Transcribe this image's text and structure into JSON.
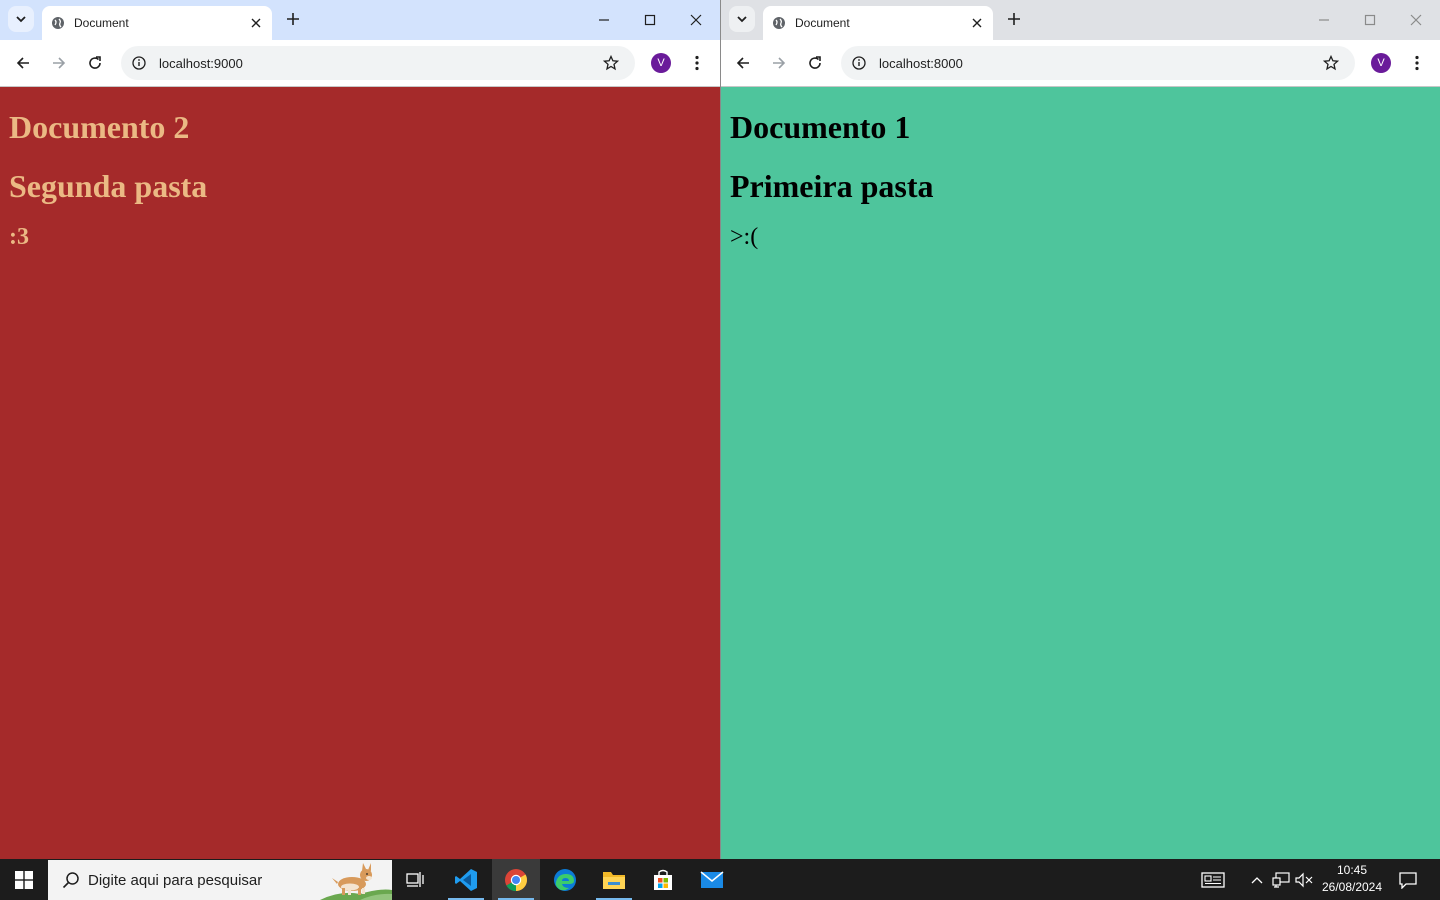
{
  "windows": [
    {
      "id": "left",
      "tab_title": "Document",
      "url": "localhost:9000",
      "avatar_letter": "V",
      "page": {
        "heading1": "Documento 2",
        "heading2": "Segunda pasta",
        "heading3": ":3"
      },
      "colors": {
        "background": "#a52a2a",
        "text": "#ebb984"
      }
    },
    {
      "id": "right",
      "tab_title": "Document",
      "url": "localhost:8000",
      "avatar_letter": "V",
      "page": {
        "heading1": "Documento 1",
        "heading2": "Primeira pasta",
        "heading3": ">:("
      },
      "colors": {
        "background": "#4ec59c",
        "text": "#000000"
      }
    }
  ],
  "taskbar": {
    "search_placeholder": "Digite aqui para pesquisar",
    "apps": [
      "task-view-icon",
      "vscode-icon",
      "chrome-icon",
      "edge-icon",
      "file-explorer-icon",
      "microsoft-store-icon",
      "mail-icon"
    ],
    "active_app": "chrome-icon",
    "clock": {
      "time": "10:45",
      "date": "26/08/2024"
    }
  }
}
